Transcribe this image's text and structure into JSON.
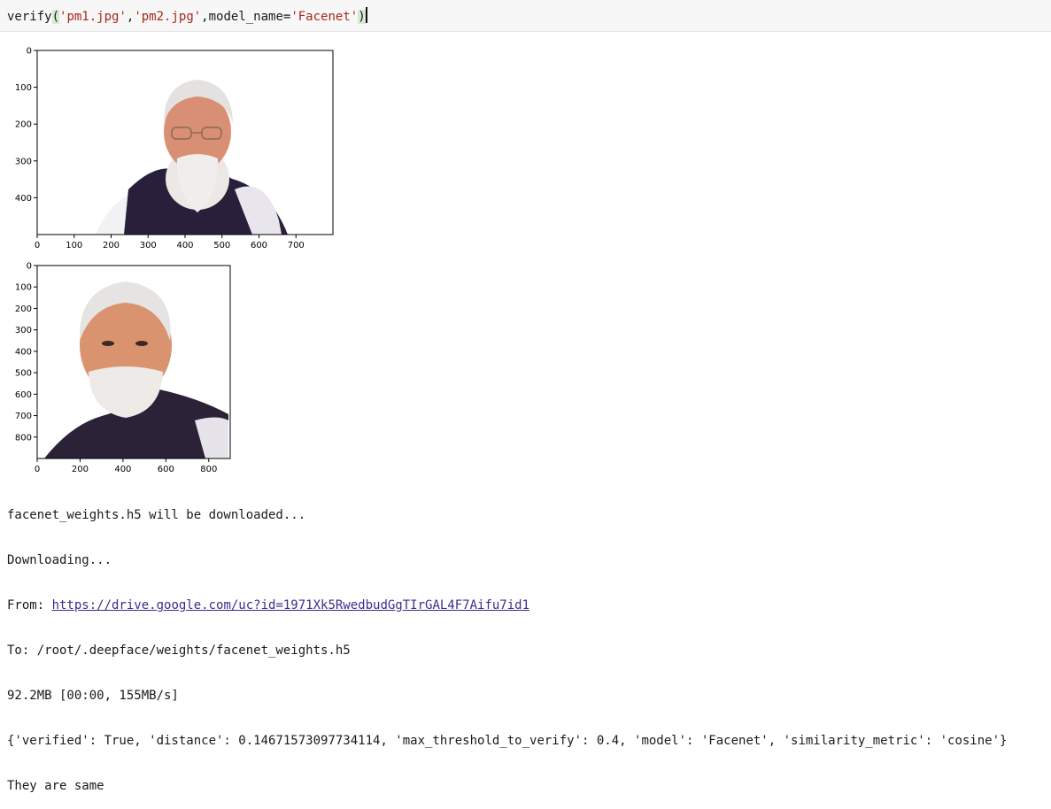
{
  "code_cell": {
    "fn": "verify",
    "open_paren": "(",
    "arg1": "'pm1.jpg'",
    "comma1": ",",
    "arg2": "'pm2.jpg'",
    "kw": ",model_name=",
    "arg3": "'Facenet'",
    "close_paren": ")"
  },
  "plot1": {
    "x_ticks": [
      "0",
      "100",
      "200",
      "300",
      "400",
      "500",
      "600",
      "700"
    ],
    "y_ticks": [
      "0",
      "100",
      "200",
      "300",
      "400"
    ],
    "xlim": [
      0,
      800
    ],
    "ylim": [
      0,
      500
    ]
  },
  "plot2": {
    "x_ticks": [
      "0",
      "200",
      "400",
      "600",
      "800"
    ],
    "y_ticks": [
      "0",
      "100",
      "200",
      "300",
      "400",
      "500",
      "600",
      "700",
      "800"
    ],
    "xlim": [
      0,
      900
    ],
    "ylim": [
      0,
      900
    ]
  },
  "output": {
    "line1": "facenet_weights.h5 will be downloaded...",
    "line2": "Downloading...",
    "from_label": "From: ",
    "from_url": "https://drive.google.com/uc?id=1971Xk5RwedbudGgTIrGAL4F7Aifu7id1",
    "to_line": "To: /root/.deepface/weights/facenet_weights.h5",
    "progress_line": "92.2MB [00:00, 155MB/s]",
    "result_line": "{'verified': True, 'distance': 0.14671573097734114, 'max_threshold_to_verify': 0.4, 'model': 'Facenet', 'similarity_metric': 'cosine'}",
    "final_line": "They are same"
  }
}
